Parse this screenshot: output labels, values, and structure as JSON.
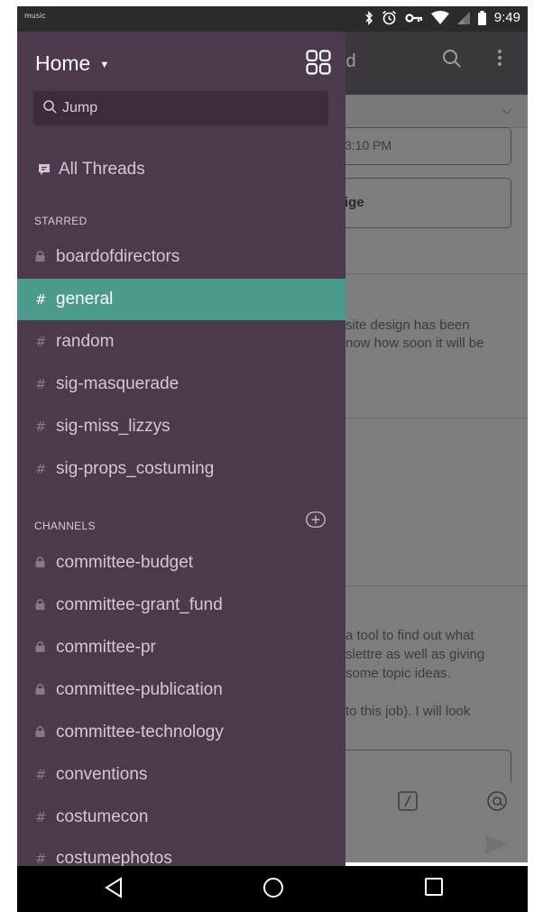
{
  "status_bar": {
    "notification_label": "music",
    "time": "9:49",
    "icons": [
      "bluetooth-icon",
      "alarm-icon",
      "vpn-key-icon",
      "wifi-icon",
      "signal-icon",
      "battery-icon"
    ]
  },
  "background_app": {
    "title_fragment": "ld",
    "message_time_fragment": "3:10 PM",
    "button_fragment": "ige",
    "message_1": [
      "site design has been",
      "now how soon it will be"
    ],
    "message_2": [
      "a tool to find out what",
      "slettre as well as giving",
      "some topic ideas."
    ],
    "message_3": "to this job). I will look"
  },
  "drawer": {
    "workspace_title": "Home",
    "jump_placeholder": "Jump",
    "all_threads_label": "All Threads",
    "starred_header": "STARRED",
    "starred": [
      {
        "name": "boardofdirectors",
        "icon": "lock-icon",
        "glyph": "",
        "active": false
      },
      {
        "name": "general",
        "icon": "hash-icon",
        "glyph": "#",
        "active": true
      },
      {
        "name": "random",
        "icon": "hash-icon",
        "glyph": "#",
        "active": false
      },
      {
        "name": "sig-masquerade",
        "icon": "hash-icon",
        "glyph": "#",
        "active": false
      },
      {
        "name": "sig-miss_lizzys",
        "icon": "hash-icon",
        "glyph": "#",
        "active": false
      },
      {
        "name": "sig-props_costuming",
        "icon": "hash-icon",
        "glyph": "#",
        "active": false
      }
    ],
    "channels_header": "CHANNELS",
    "channels": [
      {
        "name": "committee-budget",
        "icon": "lock-icon",
        "glyph": ""
      },
      {
        "name": "committee-grant_fund",
        "icon": "lock-icon",
        "glyph": ""
      },
      {
        "name": "committee-pr",
        "icon": "lock-icon",
        "glyph": ""
      },
      {
        "name": "committee-publication",
        "icon": "lock-icon",
        "glyph": ""
      },
      {
        "name": "committee-technology",
        "icon": "lock-icon",
        "glyph": ""
      },
      {
        "name": "conventions",
        "icon": "hash-icon",
        "glyph": "#"
      },
      {
        "name": "costumecon",
        "icon": "hash-icon",
        "glyph": "#"
      },
      {
        "name": "costumephotos",
        "icon": "hash-icon",
        "glyph": "#"
      }
    ]
  },
  "colors": {
    "drawer_bg": "#4d394c",
    "active_row": "#4b9b8c",
    "jump_bg": "#3c2c3b"
  }
}
